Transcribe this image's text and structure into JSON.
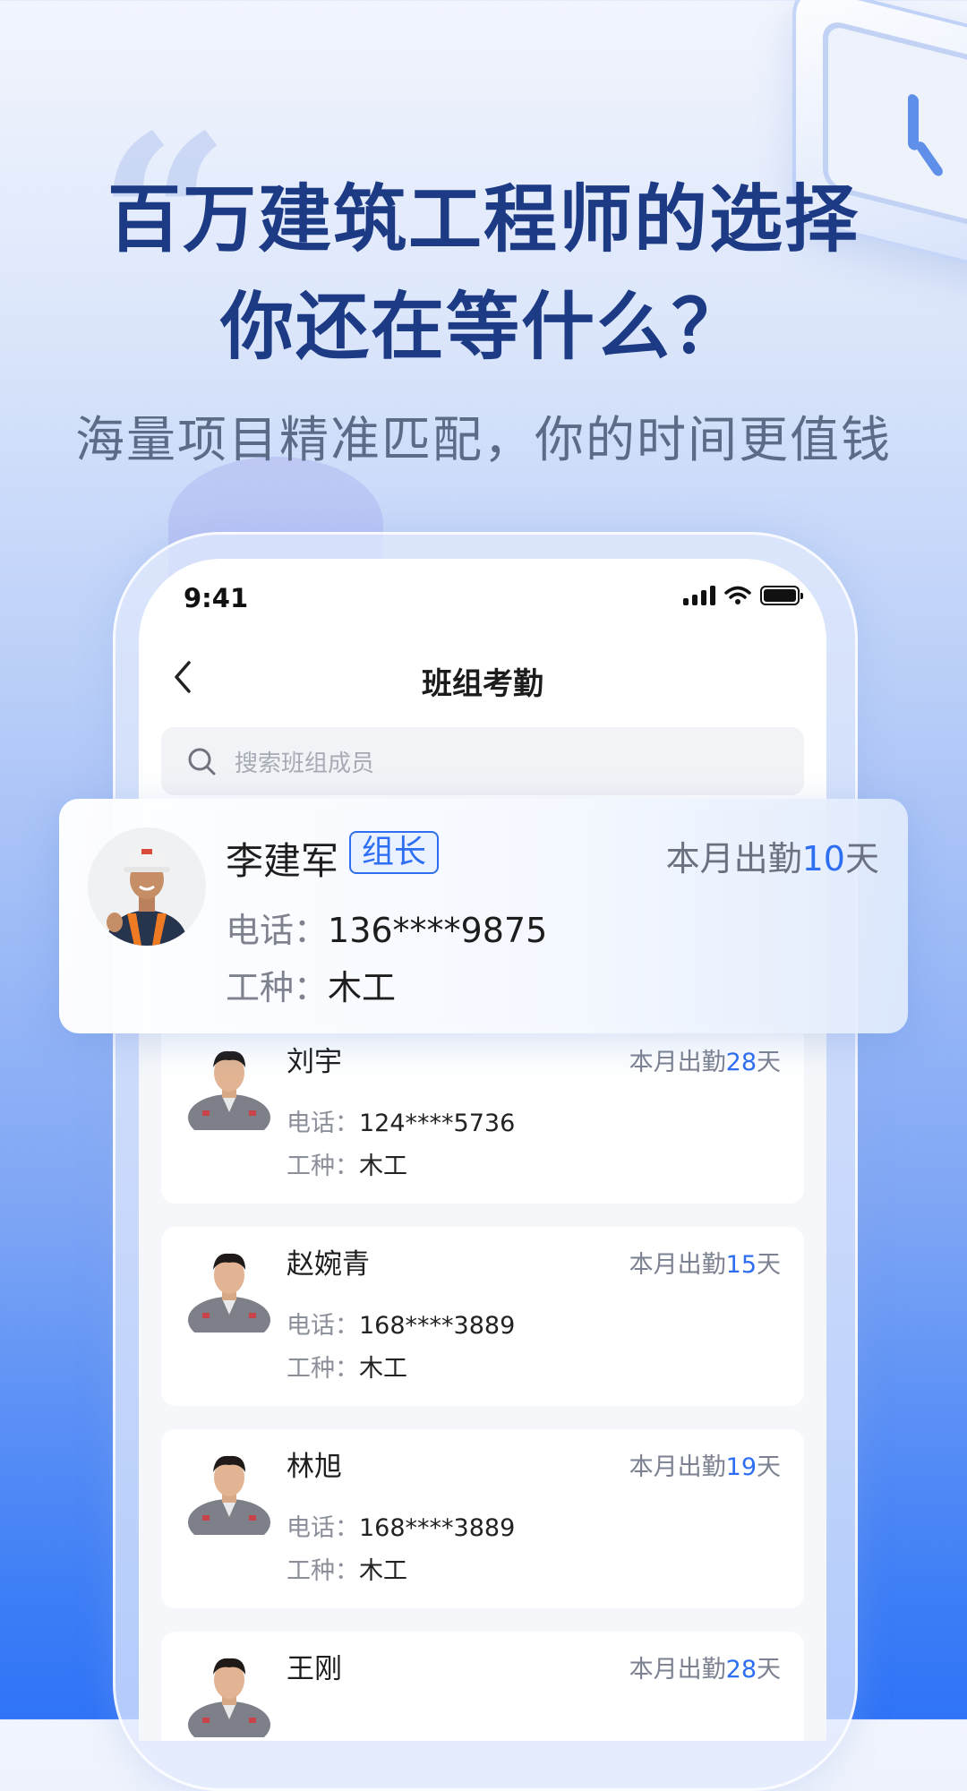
{
  "promo": {
    "headline_line1": "百万建筑工程师的选择",
    "headline_line2": "你还在等什么？",
    "subline": "海量项目精准匹配，你的时间更值钱"
  },
  "status_bar": {
    "time": "9:41"
  },
  "nav": {
    "back_icon": "chevron-left-icon",
    "title": "班组考勤"
  },
  "search": {
    "placeholder": "搜索班组成员"
  },
  "leader": {
    "name": "李建军",
    "badge": "组长",
    "attendance_prefix": "本月出勤",
    "attendance_days": "10",
    "attendance_suffix": "天",
    "phone_label": "电话：",
    "phone": "136****9875",
    "trade_label": "工种：",
    "trade": "木工"
  },
  "members": [
    {
      "name": "刘宇",
      "attendance_prefix": "本月出勤",
      "attendance_days": "28",
      "attendance_suffix": "天",
      "phone_label": "电话：",
      "phone": "124****5736",
      "trade_label": "工种：",
      "trade": "木工"
    },
    {
      "name": "赵婉青",
      "attendance_prefix": "本月出勤",
      "attendance_days": "15",
      "attendance_suffix": "天",
      "phone_label": "电话：",
      "phone": "168****3889",
      "trade_label": "工种：",
      "trade": "木工"
    },
    {
      "name": "林旭",
      "attendance_prefix": "本月出勤",
      "attendance_days": "19",
      "attendance_suffix": "天",
      "phone_label": "电话：",
      "phone": "168****3889",
      "trade_label": "工种：",
      "trade": "木工"
    },
    {
      "name": "王刚",
      "attendance_prefix": "本月出勤",
      "attendance_days": "28",
      "attendance_suffix": "天",
      "phone_label": "电话：",
      "phone": "",
      "trade_label": "",
      "trade": ""
    }
  ],
  "colors": {
    "accent": "#2d6ef2",
    "headline": "#1d3a85"
  }
}
